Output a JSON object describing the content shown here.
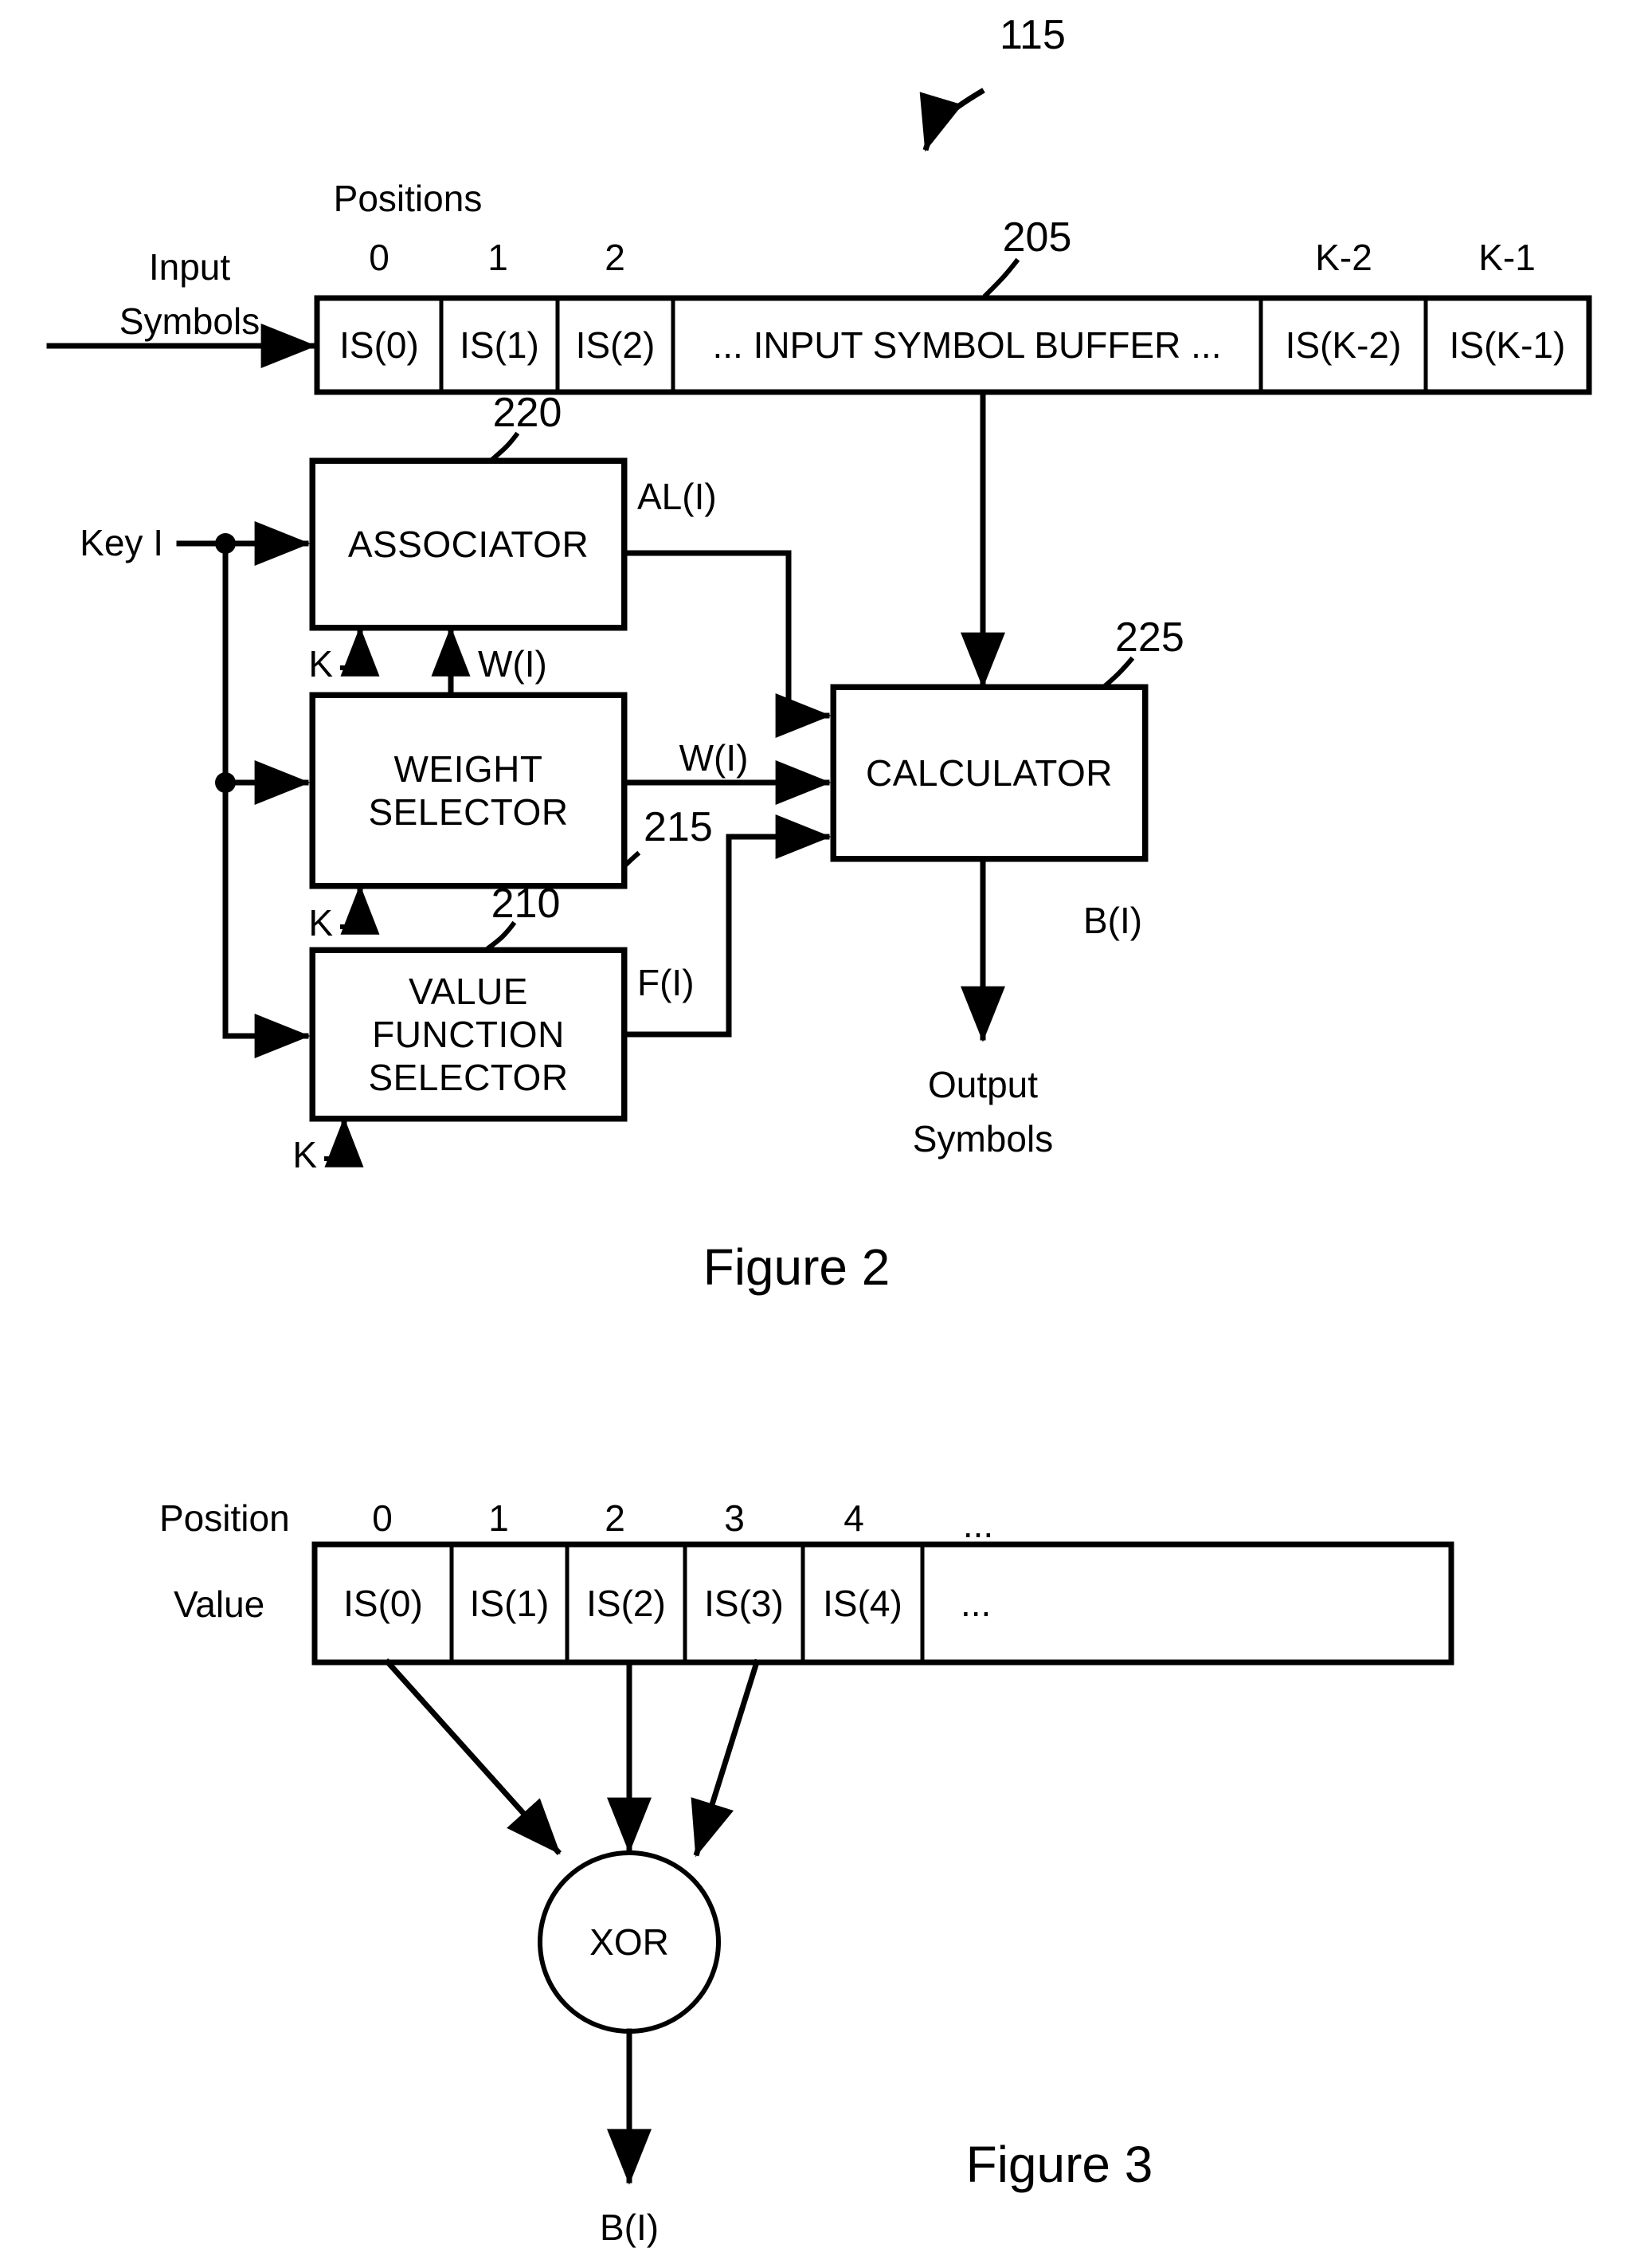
{
  "figure2": {
    "ref_main": "115",
    "positions_label": "Positions",
    "input_label_line1": "Input",
    "input_label_line2": "Symbols",
    "buffer_ref": "205",
    "buffer_positions": [
      "0",
      "1",
      "2",
      "",
      "K-2",
      "K-1"
    ],
    "buffer_cells": [
      "IS(0)",
      "IS(1)",
      "IS(2)",
      "... INPUT SYMBOL BUFFER ...",
      "IS(K-2)",
      "IS(K-1)"
    ],
    "key_label": "Key I",
    "blocks": [
      {
        "name": "associator",
        "label": "ASSOCIATOR",
        "ref": "220"
      },
      {
        "name": "weight-selector",
        "label": "WEIGHT\nSELECTOR",
        "ref": "215"
      },
      {
        "name": "value-function",
        "label": "VALUE\nFUNCTION\nSELECTOR",
        "ref": "210"
      },
      {
        "name": "calculator",
        "label": "CALCULATOR",
        "ref": "225"
      }
    ],
    "signals": {
      "al": "AL(I)",
      "w_top": "W(I)",
      "w_out": "W(I)",
      "f": "F(I)",
      "b": "B(I)"
    },
    "k_inputs": [
      "K",
      "K",
      "K"
    ],
    "output_label_line1": "Output",
    "output_label_line2": "Symbols",
    "caption": "Figure 2"
  },
  "figure3": {
    "position_label": "Position",
    "value_label": "Value",
    "positions": [
      "0",
      "1",
      "2",
      "3",
      "4",
      "..."
    ],
    "cells": [
      "IS(0)",
      "IS(1)",
      "IS(2)",
      "IS(3)",
      "IS(4)",
      "..."
    ],
    "xor_label": "XOR",
    "output_signal": "B(I)",
    "caption": "Figure 3"
  }
}
